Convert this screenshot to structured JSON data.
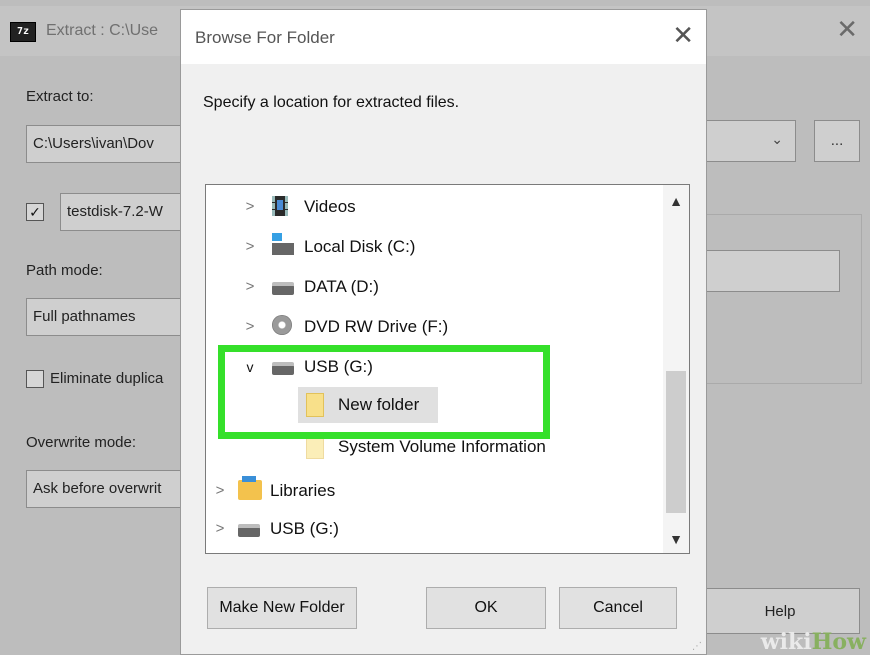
{
  "background_window": {
    "title": "Extract : C:\\Use",
    "app_icon_text": "7z",
    "extract_to_label": "Extract to:",
    "extract_to_value": "C:\\Users\\ivan\\Dov",
    "folder_name_value": "testdisk-7.2-W",
    "path_mode_label": "Path mode:",
    "path_mode_value": "Full pathnames",
    "eliminate_label": "Eliminate duplica",
    "overwrite_mode_label": "Overwrite mode:",
    "overwrite_mode_value": "Ask before overwrit",
    "browse_button": "...",
    "help_button": "Help"
  },
  "dialog": {
    "title": "Browse For Folder",
    "instruction": "Specify a location for extracted files.",
    "tree": [
      {
        "label": "Videos",
        "expander": ">",
        "icon": "video-folder-icon"
      },
      {
        "label": "Local Disk (C:)",
        "expander": ">",
        "icon": "windows-disk-icon"
      },
      {
        "label": "DATA (D:)",
        "expander": ">",
        "icon": "disk-icon"
      },
      {
        "label": "DVD RW Drive (F:)",
        "expander": ">",
        "icon": "dvd-icon"
      },
      {
        "label": "USB (G:)",
        "expander": "v",
        "icon": "usb-drive-icon"
      },
      {
        "label": "New folder",
        "expander": "",
        "icon": "folder-icon",
        "selected": true
      },
      {
        "label": "System Volume Information",
        "expander": "",
        "icon": "folder-icon"
      },
      {
        "label": "Libraries",
        "expander": ">",
        "icon": "libraries-icon"
      },
      {
        "label": "USB (G:)",
        "expander": ">",
        "icon": "usb-drive-icon"
      }
    ],
    "buttons": {
      "make_new_folder": "Make New Folder",
      "ok": "OK",
      "cancel": "Cancel"
    }
  },
  "watermark": {
    "part1": "wiki",
    "part2": "How"
  },
  "colors": {
    "highlight": "#35e02a",
    "selection": "#e0e0e0"
  }
}
